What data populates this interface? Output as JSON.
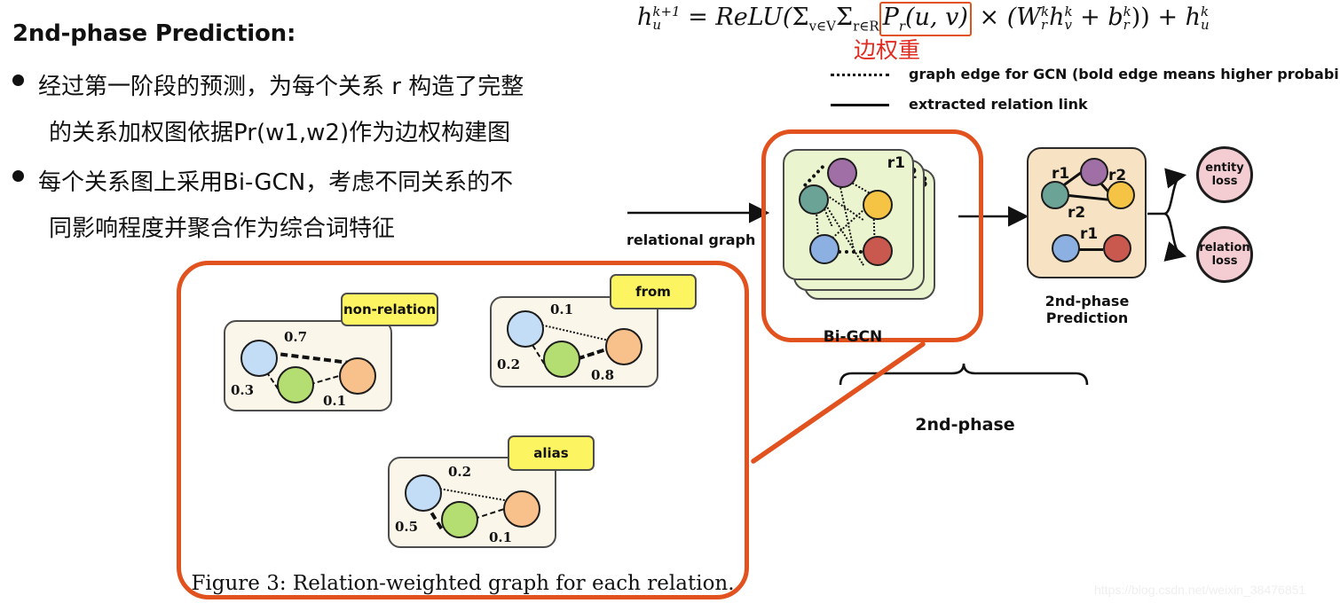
{
  "slide": {
    "heading": "2nd-phase Prediction:",
    "bullets": [
      {
        "line1": "经过第一阶段的预测，为每个关系 r 构造了完整",
        "line2_a": "的关系加权图依据P",
        "line2_sub": "r",
        "line2_b": "(w1,w2)作为边权构建图"
      },
      {
        "line1": "每个关系图上采用Bi-GCN，考虑不同关系的不",
        "line2_a": "同影响程度并聚合作为综合词特征",
        "line2_sub": "",
        "line2_b": ""
      }
    ]
  },
  "formula": {
    "lhs_h": "h",
    "lhs_sup": "k+1",
    "lhs_sub": "u",
    "eq": "=",
    "relu": "ReLU(",
    "sum1": "Σ",
    "sum1_sub": "v∈V",
    "sum2": "Σ",
    "sum2_sub": "r∈R",
    "boxed": "P",
    "boxed_sub": "r",
    "boxed_args": "(u, v)",
    "times": "×",
    "mid": "(W",
    "w_sup": "k",
    "w_sub": "r",
    "h2": "h",
    "h2_sup": "k",
    "h2_sub": "v",
    "plus": "+",
    "b": "b",
    "b_sup": "k",
    "b_sub": "r",
    "close": "))",
    "plus2": "+",
    "tail_h": "h",
    "tail_sup": "k",
    "tail_sub": "u",
    "annotation": "边权重",
    "annotation_color": "#e02b20",
    "highlight_box_color": "#e2521f"
  },
  "legend": [
    {
      "style": "dotted",
      "label": "graph edge for GCN (bold edge means higher probability)"
    },
    {
      "style": "solid",
      "label": "extracted relation link"
    }
  ],
  "pipeline": {
    "relational_graph_label": "relational graph",
    "bigcn_caption": "Bi-GCN",
    "bigcn_layer_labels": [
      "r1",
      "r2",
      "r3"
    ],
    "prediction_caption_line1": "2nd-phase",
    "prediction_caption_line2": "Prediction",
    "prediction_edge_labels": [
      "r1",
      "r2",
      "r2",
      "r1"
    ],
    "losses": [
      {
        "line1": "entity",
        "line2": "loss"
      },
      {
        "line1": "relation",
        "line2": "loss"
      }
    ],
    "brace_label": "2nd-phase",
    "highlight_color": "#e2521f",
    "node_colors": {
      "purple": "#a06fa5",
      "teal": "#6ba396",
      "yellow": "#f5c444",
      "blue": "#8cb0e2",
      "red": "#c9584f"
    }
  },
  "figure3": {
    "caption": "Figure 3: Relation-weighted graph for each relation.",
    "panel_border_color": "#e2521f",
    "graphs": [
      {
        "tag": "non-relation",
        "weights": {
          "top": "0.7",
          "left": "0.3",
          "bottom": "0.1"
        },
        "bold_edge": "top"
      },
      {
        "tag": "from",
        "weights": {
          "top": "0.1",
          "left": "0.2",
          "bottom": "0.8"
        },
        "bold_edge": "bottom"
      },
      {
        "tag": "alias",
        "weights": {
          "top": "0.2",
          "left": "0.5",
          "bottom": "0.1"
        },
        "bold_edge": "left"
      }
    ],
    "node_colors": {
      "blue": "#c3ddf6",
      "green": "#b5de72",
      "orange": "#f8c08a"
    }
  },
  "watermark": "https://blog.csdn.net/weixin_38476851"
}
